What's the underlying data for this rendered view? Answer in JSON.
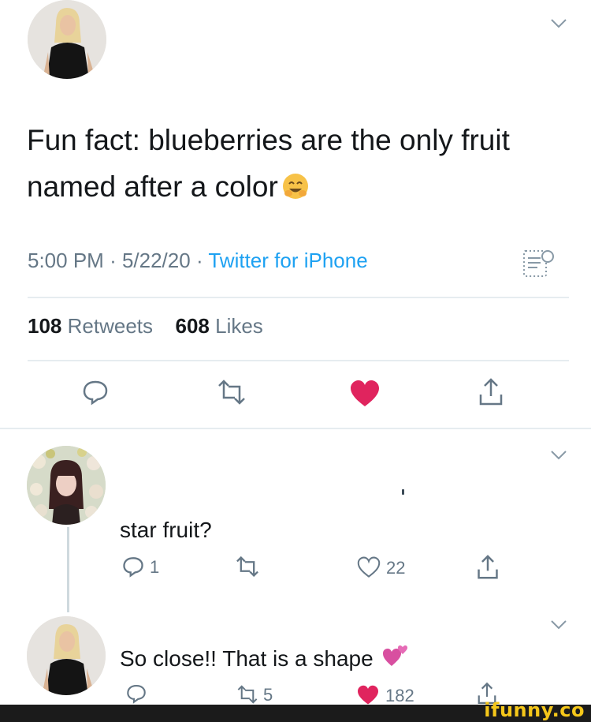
{
  "tweet": {
    "text_line1": "Fun fact: blueberries are the only fruit",
    "text_line2": "named after a color",
    "time": "5:00 PM",
    "date": "5/22/20",
    "source": "Twitter for iPhone",
    "retweets_count": "108",
    "retweets_label": "Retweets",
    "likes_count": "608",
    "likes_label": "Likes",
    "liked": true,
    "emoji": "smiling-face-emoji"
  },
  "replies": [
    {
      "text": "star fruit?",
      "reply_count": "1",
      "like_count": "22",
      "liked": false
    },
    {
      "text": "So close!! That is a shape",
      "emoji": "two-hearts-emoji",
      "retweet_count": "5",
      "like_count": "182",
      "liked": true
    }
  ],
  "watermark": "ifunny.co",
  "colors": {
    "accent": "#1da1f2",
    "like": "#e0245e",
    "muted": "#657786",
    "text": "#14171a",
    "watermark": "#f5c71a"
  }
}
